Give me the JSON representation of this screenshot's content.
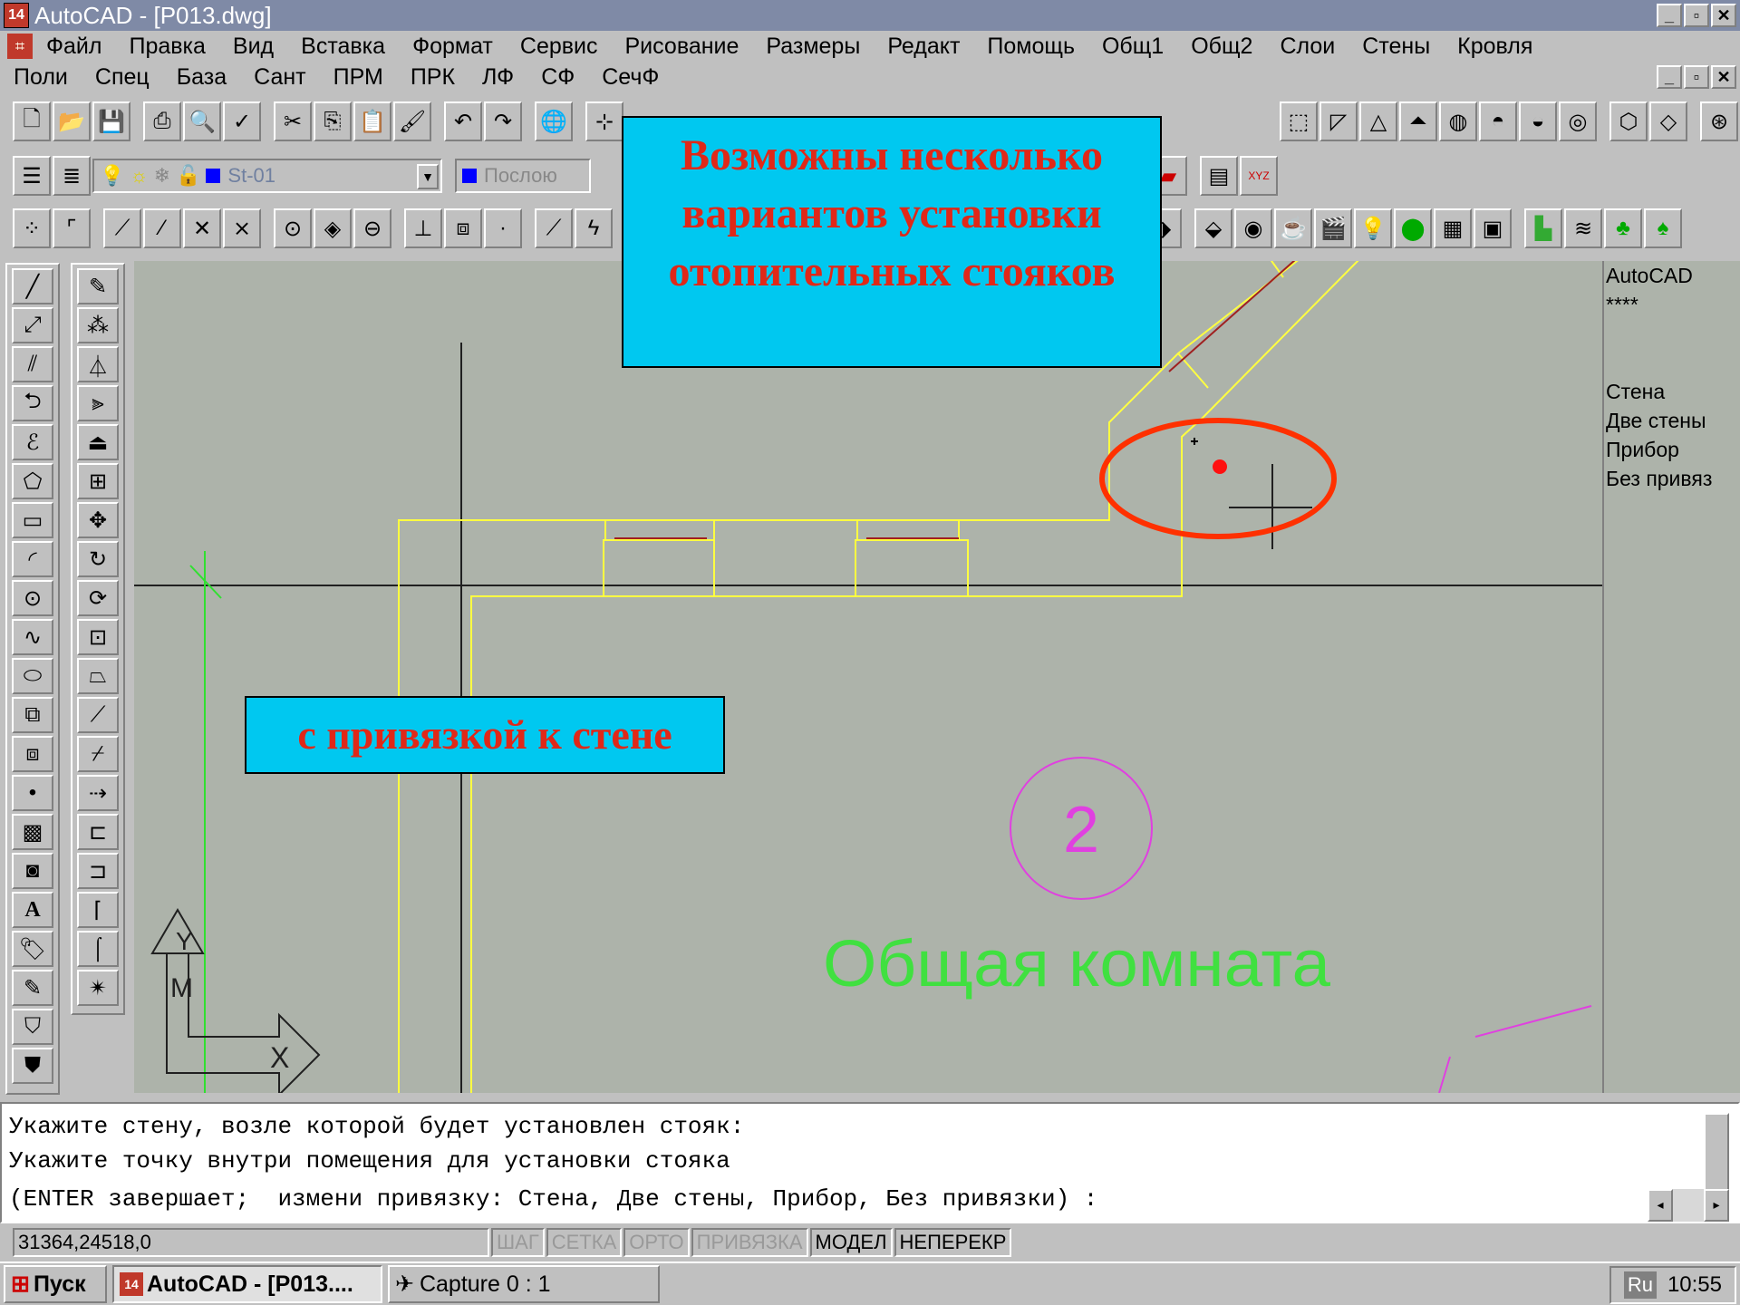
{
  "window": {
    "title": "AutoCAD - [P013.dwg]",
    "icon_label": "14",
    "controls": [
      "_",
      "▫",
      "✕"
    ]
  },
  "menubar1": [
    "Файл",
    "Правка",
    "Вид",
    "Вставка",
    "Формат",
    "Сервис",
    "Рисование",
    "Размеры",
    "Редакт",
    "Помощь",
    "Общ1",
    "Общ2",
    "Слои",
    "Стены",
    "Кровля"
  ],
  "menubar2": [
    "Поли",
    "Спец",
    "База",
    "Сант",
    "ПРМ",
    "ПРК",
    "ЛФ",
    "СФ",
    "СечФ"
  ],
  "toolbar2": {
    "layer_name": "St-01",
    "linetype": "Послою"
  },
  "screen_menu": [
    "AutoCAD",
    "****",
    "",
    "",
    "Стена",
    "Две стены",
    "Прибор",
    "Без привяз"
  ],
  "callouts": {
    "top": [
      "Возможны несколько",
      "вариантов установки",
      "отопительных стояков"
    ],
    "bottom": "с привязкой к стене"
  },
  "drawing": {
    "room_number": "2",
    "room_name": "Общая комната",
    "ucs_y": "Y",
    "ucs_x": "X",
    "ucs_m": "M"
  },
  "command": {
    "line1": "Укажите стену, возле которой будет установлен стояк:",
    "line2": "Укажите точку внутри помещения для установки стояка",
    "line3": "(ENTER завершает;  измени привязку: Стена, Две стены, Прибор, Без привязки) :"
  },
  "status": {
    "coords": "31364,24518,0",
    "toggles": [
      {
        "label": "ШАГ",
        "on": false
      },
      {
        "label": "СЕТКА",
        "on": false
      },
      {
        "label": "ОРТО",
        "on": false
      },
      {
        "label": "ПРИВЯЗКА",
        "on": false
      },
      {
        "label": "МОДЕЛ",
        "on": true
      },
      {
        "label": "НЕПЕРЕКР",
        "on": true
      }
    ]
  },
  "taskbar": {
    "start": "Пуск",
    "task1": "AutoCAD - [P013....",
    "task2": "Capture 0 : 1",
    "lang": "Ru",
    "clock": "10:55"
  },
  "colors": {
    "canvas_bg": "#adb3aa",
    "wall": "#ffff40",
    "callout_bg": "#00c8f0",
    "callout_text": "#e02818",
    "room_text": "#40e040",
    "room_circle": "#e040e0",
    "highlight_ellipse": "#ff3000"
  }
}
